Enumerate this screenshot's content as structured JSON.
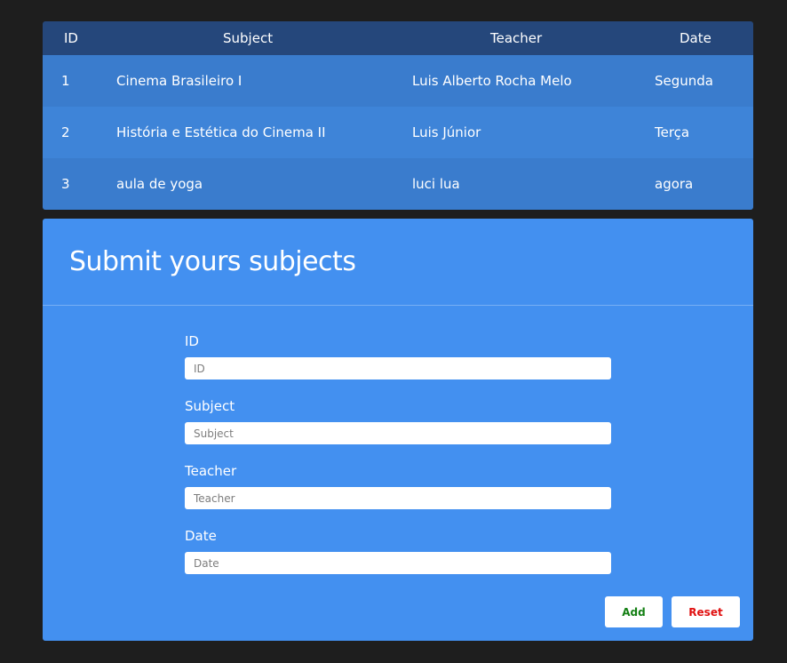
{
  "table": {
    "headers": {
      "id": "ID",
      "subject": "Subject",
      "teacher": "Teacher",
      "date": "Date"
    },
    "rows": [
      {
        "id": "1",
        "subject": "Cinema Brasileiro I",
        "teacher": "Luis Alberto Rocha Melo",
        "date": "Segunda"
      },
      {
        "id": "2",
        "subject": "História e Estética do Cinema II",
        "teacher": "Luis Júnior",
        "date": "Terça"
      },
      {
        "id": "3",
        "subject": "aula de yoga",
        "teacher": "luci lua",
        "date": "agora"
      }
    ]
  },
  "form": {
    "title": "Submit yours subjects",
    "fields": {
      "id": {
        "label": "ID",
        "placeholder": "ID",
        "value": ""
      },
      "subject": {
        "label": "Subject",
        "placeholder": "Subject",
        "value": ""
      },
      "teacher": {
        "label": "Teacher",
        "placeholder": "Teacher",
        "value": ""
      },
      "date": {
        "label": "Date",
        "placeholder": "Date",
        "value": ""
      }
    },
    "buttons": {
      "add": "Add",
      "reset": "Reset"
    }
  },
  "colors": {
    "background": "#1e1e1e",
    "table_header": "#25477b",
    "row_odd": "#3a7ccd",
    "row_even": "#3e84d8",
    "form_background": "#4390f0",
    "add_text": "#137f13",
    "reset_text": "#e01010"
  }
}
